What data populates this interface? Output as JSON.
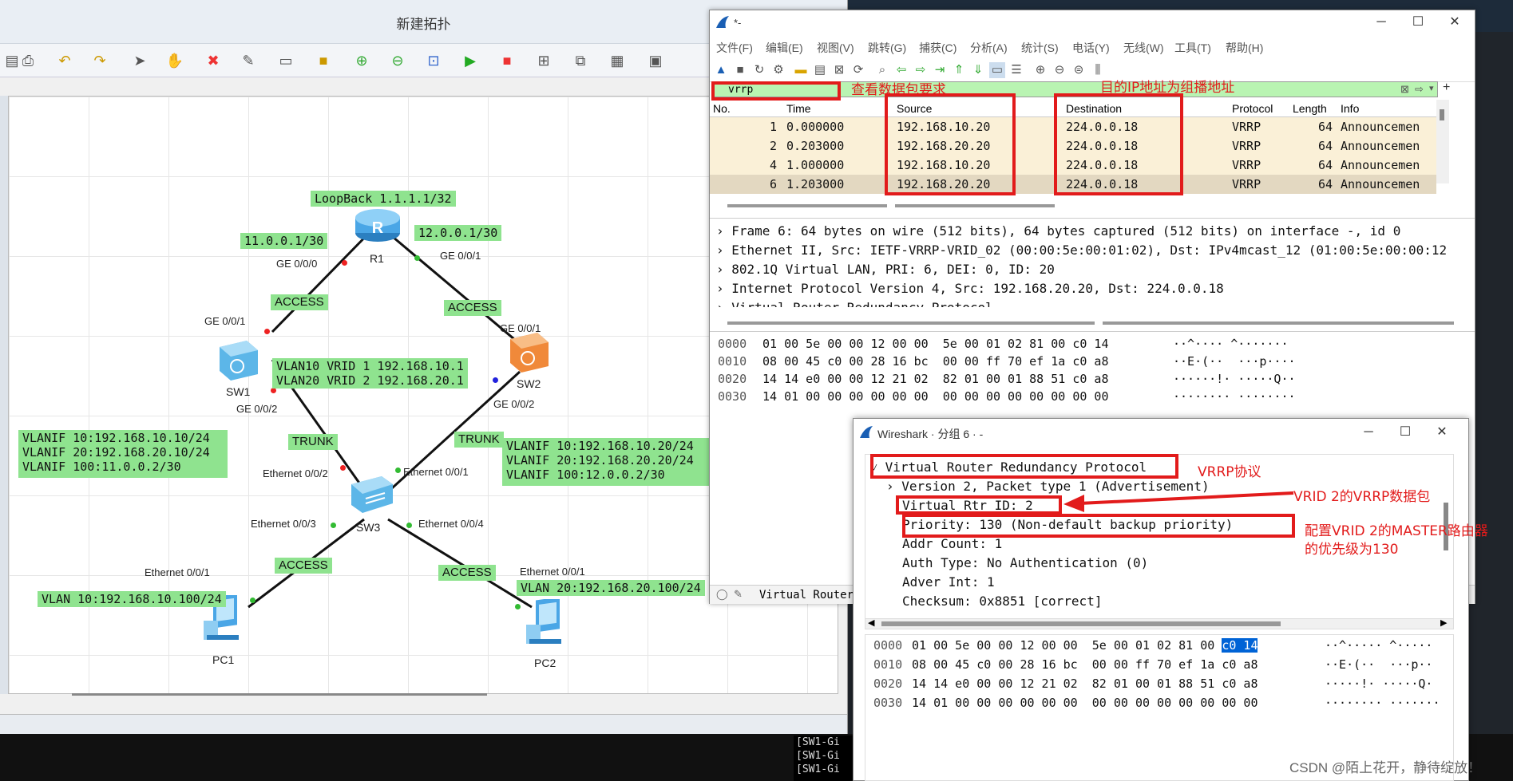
{
  "ensp": {
    "title": "新建拓扑",
    "labels": {
      "loopback": "LoopBack 1.1.1.1/32",
      "r1_left_ip": "11.0.0.1/30",
      "r1_right_ip": "12.0.0.1/30",
      "vrid": "VLAN10 VRID 1 192.168.10.1\nVLAN20 VRID 2 192.168.20.1",
      "sw1_vlanif": "VLANIF 10:192.168.10.10/24\nVLANIF 20:192.168.20.10/24\nVLANIF 100:11.0.0.2/30",
      "sw2_vlanif": "VLANIF 10:192.168.10.20/24\nVLANIF 20:192.168.20.20/24\nVLANIF 100:12.0.0.2/30",
      "pc1_vlan": "VLAN 10:192.168.10.100/24",
      "pc2_vlan": "VLAN 20:192.168.20.100/24",
      "access": "ACCESS",
      "trunk": "TRUNK"
    },
    "devices": {
      "r1": "R1",
      "r1_icon_letter": "R",
      "sw1": "SW1",
      "sw2": "SW2",
      "sw3": "SW3",
      "pc1": "PC1",
      "pc2": "PC2"
    },
    "ports": {
      "r1_ge000": "GE 0/0/0",
      "r1_ge001": "GE 0/0/1",
      "sw1_ge001": "GE 0/0/1",
      "sw1_ge002": "GE 0/0/2",
      "sw2_ge001": "GE 0/0/1",
      "sw2_ge002": "GE 0/0/2",
      "sw3_e002": "Ethernet 0/0/2",
      "sw3_e001": "Ethernet 0/0/1",
      "sw3_e003": "Ethernet 0/0/3",
      "sw3_e004": "Ethernet 0/0/4",
      "pc1_e001": "Ethernet 0/0/1",
      "pc2_e001": "Ethernet 0/0/1"
    }
  },
  "wireshark": {
    "title": "*-",
    "menu": [
      "文件(F)",
      "编辑(E)",
      "视图(V)",
      "跳转(G)",
      "捕获(C)",
      "分析(A)",
      "统计(S)",
      "电话(Y)",
      "无线(W)",
      "工具(T)",
      "帮助(H)"
    ],
    "filter": "vrrp",
    "columns": [
      "No.",
      "Time",
      "Source",
      "Destination",
      "Protocol",
      "Length",
      "Info"
    ],
    "packets": [
      {
        "no": "1",
        "time": "0.000000",
        "src": "192.168.10.20",
        "dst": "224.0.0.18",
        "proto": "VRRP",
        "len": "64",
        "info": "Announcemen"
      },
      {
        "no": "2",
        "time": "0.203000",
        "src": "192.168.20.20",
        "dst": "224.0.0.18",
        "proto": "VRRP",
        "len": "64",
        "info": "Announcemen"
      },
      {
        "no": "4",
        "time": "1.000000",
        "src": "192.168.10.20",
        "dst": "224.0.0.18",
        "proto": "VRRP",
        "len": "64",
        "info": "Announcemen"
      },
      {
        "no": "6",
        "time": "1.203000",
        "src": "192.168.20.20",
        "dst": "224.0.0.18",
        "proto": "VRRP",
        "len": "64",
        "info": "Announcemen"
      }
    ],
    "details": [
      "Frame 6: 64 bytes on wire (512 bits), 64 bytes captured (512 bits) on interface -, id 0",
      "Ethernet II, Src: IETF-VRRP-VRID_02 (00:00:5e:00:01:02), Dst: IPv4mcast_12 (01:00:5e:00:00:12",
      "802.1Q Virtual LAN, PRI: 6, DEI: 0, ID: 20",
      "Internet Protocol Version 4, Src: 192.168.20.20, Dst: 224.0.0.18",
      "Virtual Router Redundancy Protocol"
    ],
    "bytes": [
      {
        "off": "0000",
        "hex": "01 00 5e 00 00 12 00 00  5e 00 01 02 81 00 c0 14",
        "ascii": "··^···· ^·······"
      },
      {
        "off": "0010",
        "hex": "08 00 45 c0 00 28 16 bc  00 00 ff 70 ef 1a c0 a8",
        "ascii": "··E·(··  ···p····"
      },
      {
        "off": "0020",
        "hex": "14 14 e0 00 00 12 21 02  82 01 00 01 88 51 c0 a8",
        "ascii": "······!· ·····Q··"
      },
      {
        "off": "0030",
        "hex": "14 01 00 00 00 00 00 00  00 00 00 00 00 00 00 00",
        "ascii": "········ ········"
      }
    ],
    "status": "Virtual Router"
  },
  "packet_window": {
    "title": "Wireshark · 分组 6 · -",
    "tree": [
      "Virtual Router Redundancy Protocol",
      "Version 2, Packet type 1 (Advertisement)",
      "Virtual Rtr ID: 2",
      "Priority: 130 (Non-default backup priority)",
      "Addr Count: 1",
      "Auth Type: No Authentication (0)",
      "Adver Int: 1",
      "Checksum: 0x8851 [correct]"
    ],
    "bytes": [
      {
        "off": "0000",
        "hex_a": "01 00 5e 00 00 12 00 00  5e 00 01 02 81 00 ",
        "hex_b": "c0 14",
        "ascii": "··^····· ^·····"
      },
      {
        "off": "0010",
        "hex_a": "08 00 45 c0 00 28 16 bc  00 00 ff 70 ef 1a c0 a8",
        "hex_b": "",
        "ascii": "··E·(··  ···p··"
      },
      {
        "off": "0020",
        "hex_a": "14 14 e0 00 00 12 21 02  82 01 00 01 88 51 c0 a8",
        "hex_b": "",
        "ascii": "·····!· ·····Q·"
      },
      {
        "off": "0030",
        "hex_a": "14 01 00 00 00 00 00 00  00 00 00 00 00 00 00 00",
        "hex_b": "",
        "ascii": "········ ·······"
      }
    ]
  },
  "annotations": {
    "filter_note": "查看数据包要求",
    "dest_note": "目的IP地址为组播地址",
    "vrrp_note": "VRRP协议",
    "vrid_note": "VRID 2的VRRP数据包",
    "priority_note_1": "配置VRID 2的MASTER路由器",
    "priority_note_2": "的优先级为130"
  },
  "console": [
    "[SW1-Gi",
    "[SW1-Gi",
    "[SW1-Gi"
  ],
  "watermark": "CSDN @陌上花开，静待绽放！",
  "colors": {
    "label_bg": "#8fe38f",
    "annotation_red": "#e21b1b",
    "row_bg": "#faf0d7",
    "filter_bg": "#b9f4b2"
  }
}
